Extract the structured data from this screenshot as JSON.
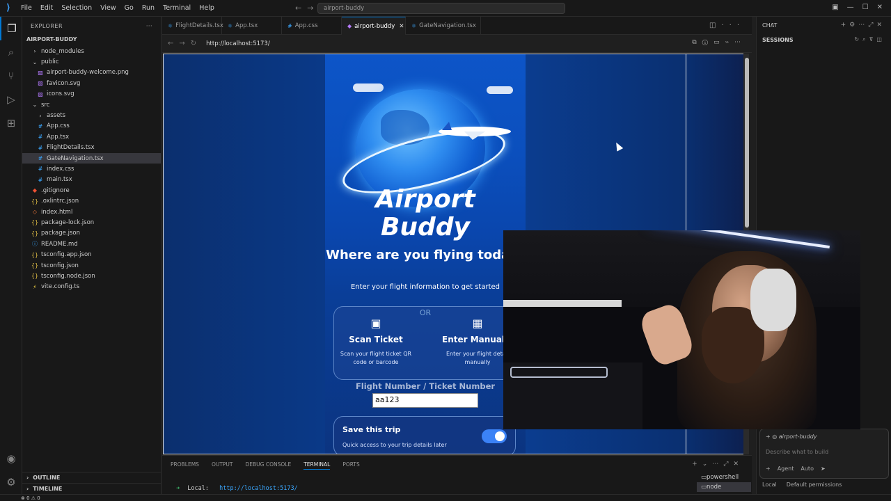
{
  "titlebar": {
    "menu": [
      "File",
      "Edit",
      "Selection",
      "View",
      "Go",
      "Run",
      "Terminal",
      "Help"
    ],
    "command_center": "airport-buddy"
  },
  "explorer": {
    "header": "EXPLORER",
    "root": "AIRPORT-BUDDY",
    "items": [
      {
        "label": "node_modules",
        "icon": "chevron-right-icon",
        "indent": 1
      },
      {
        "label": "public",
        "icon": "chevron-down-icon",
        "indent": 1
      },
      {
        "label": "airport-buddy-welcome.png",
        "icon": "image-file-icon",
        "indent": 2
      },
      {
        "label": "favicon.svg",
        "icon": "svg-file-icon",
        "indent": 2
      },
      {
        "label": "icons.svg",
        "icon": "svg-file-icon",
        "indent": 2
      },
      {
        "label": "src",
        "icon": "chevron-down-icon",
        "indent": 1
      },
      {
        "label": "assets",
        "icon": "chevron-right-icon",
        "indent": 2
      },
      {
        "label": "App.css",
        "icon": "css-file-icon",
        "indent": 2
      },
      {
        "label": "App.tsx",
        "icon": "tsx-file-icon",
        "indent": 2
      },
      {
        "label": "FlightDetails.tsx",
        "icon": "tsx-file-icon",
        "indent": 2
      },
      {
        "label": "GateNavigation.tsx",
        "icon": "tsx-file-icon",
        "indent": 2
      },
      {
        "label": "index.css",
        "icon": "css-file-icon",
        "indent": 2
      },
      {
        "label": "main.tsx",
        "icon": "tsx-file-icon",
        "indent": 2
      },
      {
        "label": ".gitignore",
        "icon": "git-file-icon",
        "indent": 1
      },
      {
        "label": ".oxlintrc.json",
        "icon": "json-file-icon",
        "indent": 1
      },
      {
        "label": "index.html",
        "icon": "html-file-icon",
        "indent": 1
      },
      {
        "label": "package-lock.json",
        "icon": "json-file-icon",
        "indent": 1
      },
      {
        "label": "package.json",
        "icon": "json-file-icon",
        "indent": 1
      },
      {
        "label": "README.md",
        "icon": "info-file-icon",
        "indent": 1
      },
      {
        "label": "tsconfig.app.json",
        "icon": "json-file-icon",
        "indent": 1
      },
      {
        "label": "tsconfig.json",
        "icon": "json-file-icon",
        "indent": 1
      },
      {
        "label": "tsconfig.node.json",
        "icon": "json-file-icon",
        "indent": 1
      },
      {
        "label": "vite.config.ts",
        "icon": "vite-file-icon",
        "indent": 1
      }
    ],
    "outline": "OUTLINE",
    "timeline": "TIMELINE"
  },
  "tabs": [
    {
      "label": "FlightDetails.tsx",
      "icon": "tsx-file-icon"
    },
    {
      "label": "App.tsx",
      "icon": "tsx-file-icon"
    },
    {
      "label": "App.css",
      "icon": "css-file-icon"
    },
    {
      "label": "airport-buddy",
      "icon": "browser-icon",
      "active": true
    },
    {
      "label": "GateNavigation.tsx",
      "icon": "tsx-file-icon"
    }
  ],
  "browser": {
    "url": "http://localhost:5173/"
  },
  "app": {
    "title_line1": "Airport",
    "title_line2": "Buddy",
    "question": "Where are you flying today?",
    "subtitle": "Enter your flight information to get started",
    "or_text": "OR",
    "scan": {
      "title": "Scan Ticket",
      "desc": "Scan your flight ticket QR code or barcode"
    },
    "manual": {
      "title": "Enter Manually",
      "desc": "Enter your flight detail manually"
    },
    "flight_label": "Flight Number / Ticket Number",
    "flight_value": "aa123",
    "save_title": "Save this trip",
    "save_sub": "Quick access to your trip details later",
    "save_toggle_on": true
  },
  "chat": {
    "title": "CHAT",
    "sessions": "SESSIONS",
    "context": "airport-buddy",
    "placeholder": "Describe what to build",
    "mode": "Agent",
    "model": "Auto",
    "footer_local": "Local",
    "footer_perms": "Default permissions"
  },
  "panel": {
    "tabs": [
      "PROBLEMS",
      "OUTPUT",
      "DEBUG CONSOLE",
      "TERMINAL",
      "PORTS"
    ],
    "active_tab": "TERMINAL",
    "terminal_label": "Local:",
    "terminal_url": "http://localhost:5173/",
    "terminals": [
      "powershell",
      "node"
    ]
  },
  "status": {
    "problems": "⊗ 0 ⚠ 0"
  },
  "colors": {
    "accent": "#0078d4",
    "app_blue": "#0b4fbd",
    "toggle": "#3b82f6"
  }
}
